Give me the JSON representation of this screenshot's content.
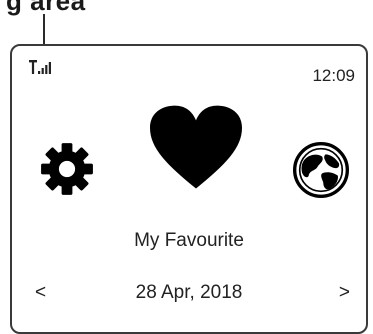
{
  "annotation": {
    "text": "g area"
  },
  "status_bar": {
    "signal_icon": "signal-strength-icon",
    "time": "12:09"
  },
  "icons": {
    "left": "gear-icon",
    "center": "heart-icon",
    "right": "globe-icon"
  },
  "main": {
    "label": "My Favourite"
  },
  "footer": {
    "prev": "<",
    "date": "28 Apr, 2018",
    "next": ">"
  }
}
